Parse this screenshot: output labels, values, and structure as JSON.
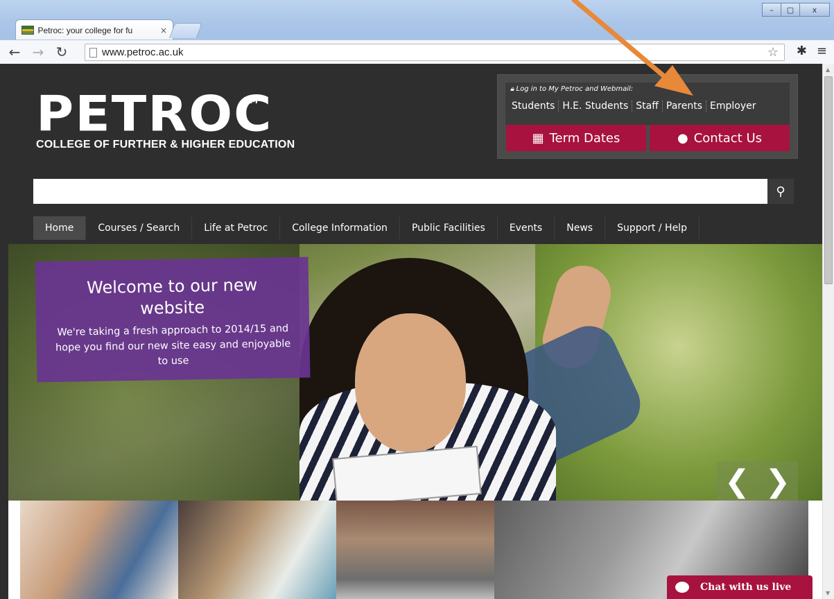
{
  "browser": {
    "tab_title": "Petroc: your college for fu",
    "tab_close": "×",
    "url": "www.petroc.ac.uk",
    "window_buttons": [
      "–",
      "▢",
      "x"
    ],
    "accent": "#a9c4e8"
  },
  "header": {
    "logo_word": "PETROC",
    "logo_tm": "TM",
    "logo_sub": "COLLEGE OF FURTHER & HIGHER EDUCATION",
    "login_label": "Log in to My Petroc and Webmail:",
    "login_links": [
      "Students",
      "H.E. Students",
      "Staff",
      "Parents",
      "Employer"
    ],
    "term_dates": "Term Dates",
    "contact_us": "Contact Us",
    "brand_red": "#a8123e"
  },
  "search": {
    "placeholder": ""
  },
  "nav": {
    "items": [
      "Home",
      "Courses / Search",
      "Life at Petroc",
      "College Information",
      "Public Facilities",
      "Events",
      "News",
      "Support / Help"
    ]
  },
  "hero": {
    "title": "Welcome to our new website",
    "body": "We're taking a fresh approach to 2014/15 and hope you find our new site easy and enjoyable to use",
    "prev": "❮",
    "next": "❯",
    "panel_color": "#693491"
  },
  "chat": {
    "label": "Chat with us live"
  },
  "annotation": {
    "arrow_color": "#e8893a"
  }
}
